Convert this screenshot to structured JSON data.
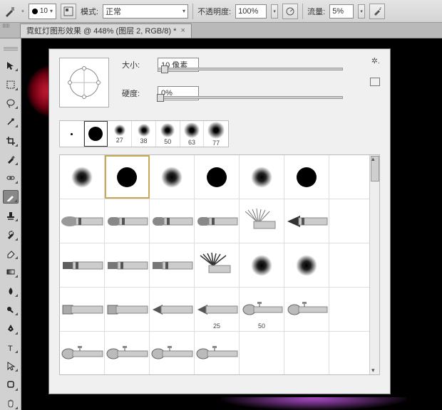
{
  "options": {
    "brush_size": "10",
    "panel_label": "模式:",
    "mode": "正常",
    "opacity_label": "不透明度:",
    "opacity": "100%",
    "flow_label": "流量:",
    "flow": "5%"
  },
  "doc": {
    "title": "霓虹灯图形效果 @ 448% (图层 2, RGB/8) *"
  },
  "panel": {
    "size_label": "大小:",
    "size_value": "10 像素",
    "hard_label": "硬度:",
    "hard_value": "0%"
  },
  "presets": [
    "",
    "",
    "27",
    "38",
    "50",
    "63",
    "77"
  ],
  "grid_labels": {
    "r3c3": "25",
    "r3c4": "50"
  }
}
